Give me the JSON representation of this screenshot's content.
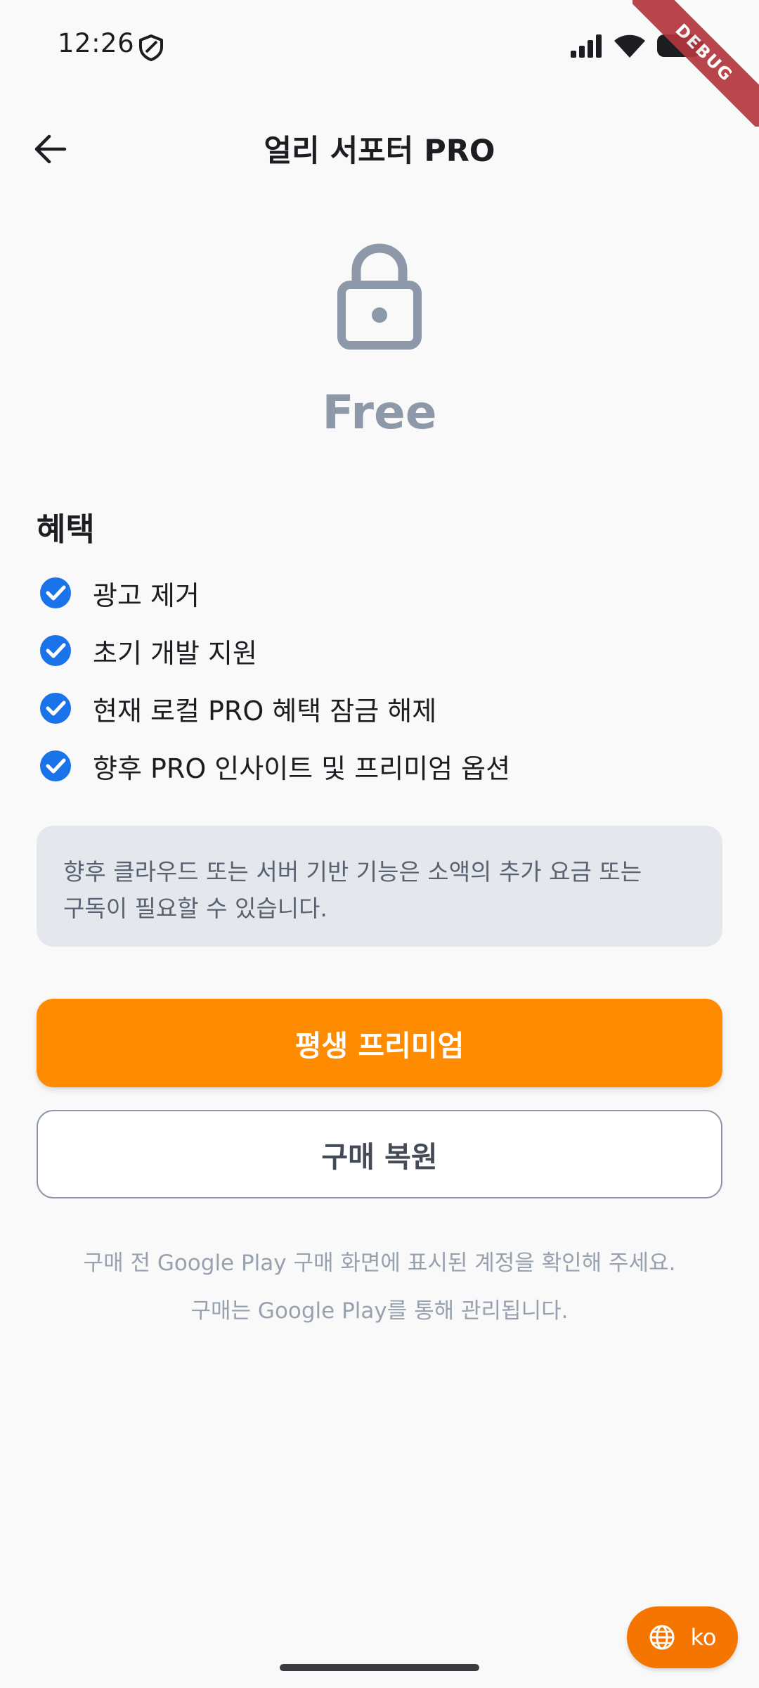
{
  "status_bar": {
    "time": "12:26",
    "icons": [
      "shield-icon",
      "signal-icon",
      "wifi-icon",
      "battery-icon"
    ],
    "debug_banner": "DEBUG"
  },
  "app_bar": {
    "back_icon": "arrow-left-icon",
    "title": "얼리 서포터 PRO"
  },
  "tier": {
    "icon": "lock-icon",
    "label": "Free"
  },
  "benefits": {
    "heading": "혜택",
    "items": [
      "광고 제거",
      "초기 개발 지원",
      "현재 로컬 PRO 혜택 잠금 해제",
      "향후 PRO 인사이트 및 프리미엄 옵션"
    ]
  },
  "notice": {
    "line1": "향후 클라우드 또는 서버 기반 기능은 소액의 추가 요금 또는",
    "line2": "구독이 필요할 수 있습니다."
  },
  "actions": {
    "primary_label": "평생 프리미엄",
    "secondary_label": "구매 복원"
  },
  "footnotes": {
    "line1": "구매 전 Google Play 구매 화면에 표시된 계정을 확인해 주세요.",
    "line2": "구매는 Google Play를 통해 관리됩니다."
  },
  "language_button": {
    "icon": "globe-icon",
    "label": "ko"
  },
  "colors": {
    "accent_orange": "#ff8c00",
    "fab_orange": "#f47500",
    "check_blue": "#1a73e8",
    "muted_gray": "#8d98a8",
    "notice_bg": "#e4e8ed",
    "background": "#f9f9fa"
  }
}
